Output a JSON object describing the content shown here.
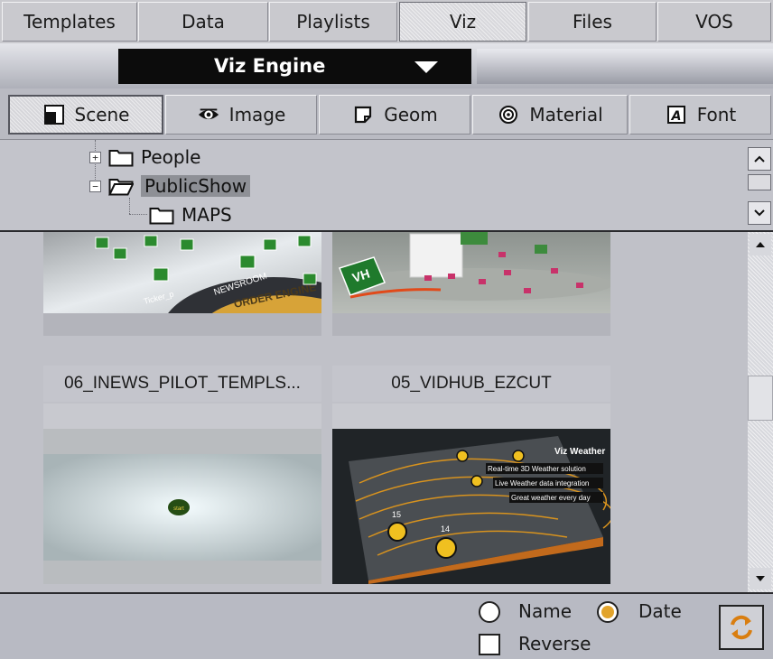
{
  "top_tabs": [
    {
      "label": "Templates"
    },
    {
      "label": "Data"
    },
    {
      "label": "Playlists"
    },
    {
      "label": "Viz",
      "active": true
    },
    {
      "label": "Files"
    },
    {
      "label": "VOS"
    }
  ],
  "engine": {
    "label": "Viz Engine",
    "icon": "dropdown-arrow-icon"
  },
  "sub_tabs": [
    {
      "label": "Scene",
      "icon": "scene-icon",
      "active": true
    },
    {
      "label": "Image",
      "icon": "eye-icon"
    },
    {
      "label": "Geom",
      "icon": "geom-icon"
    },
    {
      "label": "Material",
      "icon": "material-icon"
    },
    {
      "label": "Font",
      "icon": "font-icon"
    }
  ],
  "tree": {
    "items": [
      {
        "label": "People",
        "expander": "+"
      },
      {
        "label": "PublicShow",
        "expander": "−",
        "selected": true
      },
      {
        "label": "MAPS"
      }
    ]
  },
  "thumbnails": [
    {
      "label": "06_INEWS_PILOT_TEMPLS...",
      "image_text": [
        "NEWSROOM",
        "ORDER ENGINE",
        "Ticker_p"
      ]
    },
    {
      "label": "05_VIDHUB_EZCUT",
      "image_text": [
        "VH"
      ]
    },
    {
      "label": "",
      "image_text": [
        "start"
      ]
    },
    {
      "label": "",
      "image_text": [
        "Viz Weather",
        "Real-time 3D Weather solution",
        "Live Weather data integration",
        "Great weather every day",
        "15",
        "14"
      ]
    }
  ],
  "sort": {
    "name_label": "Name",
    "date_label": "Date",
    "selected": "Date",
    "reverse_label": "Reverse",
    "reverse_checked": false
  },
  "colors": {
    "accent_radio": "#e2a42c",
    "engine_bar": "#0c0c0c"
  }
}
